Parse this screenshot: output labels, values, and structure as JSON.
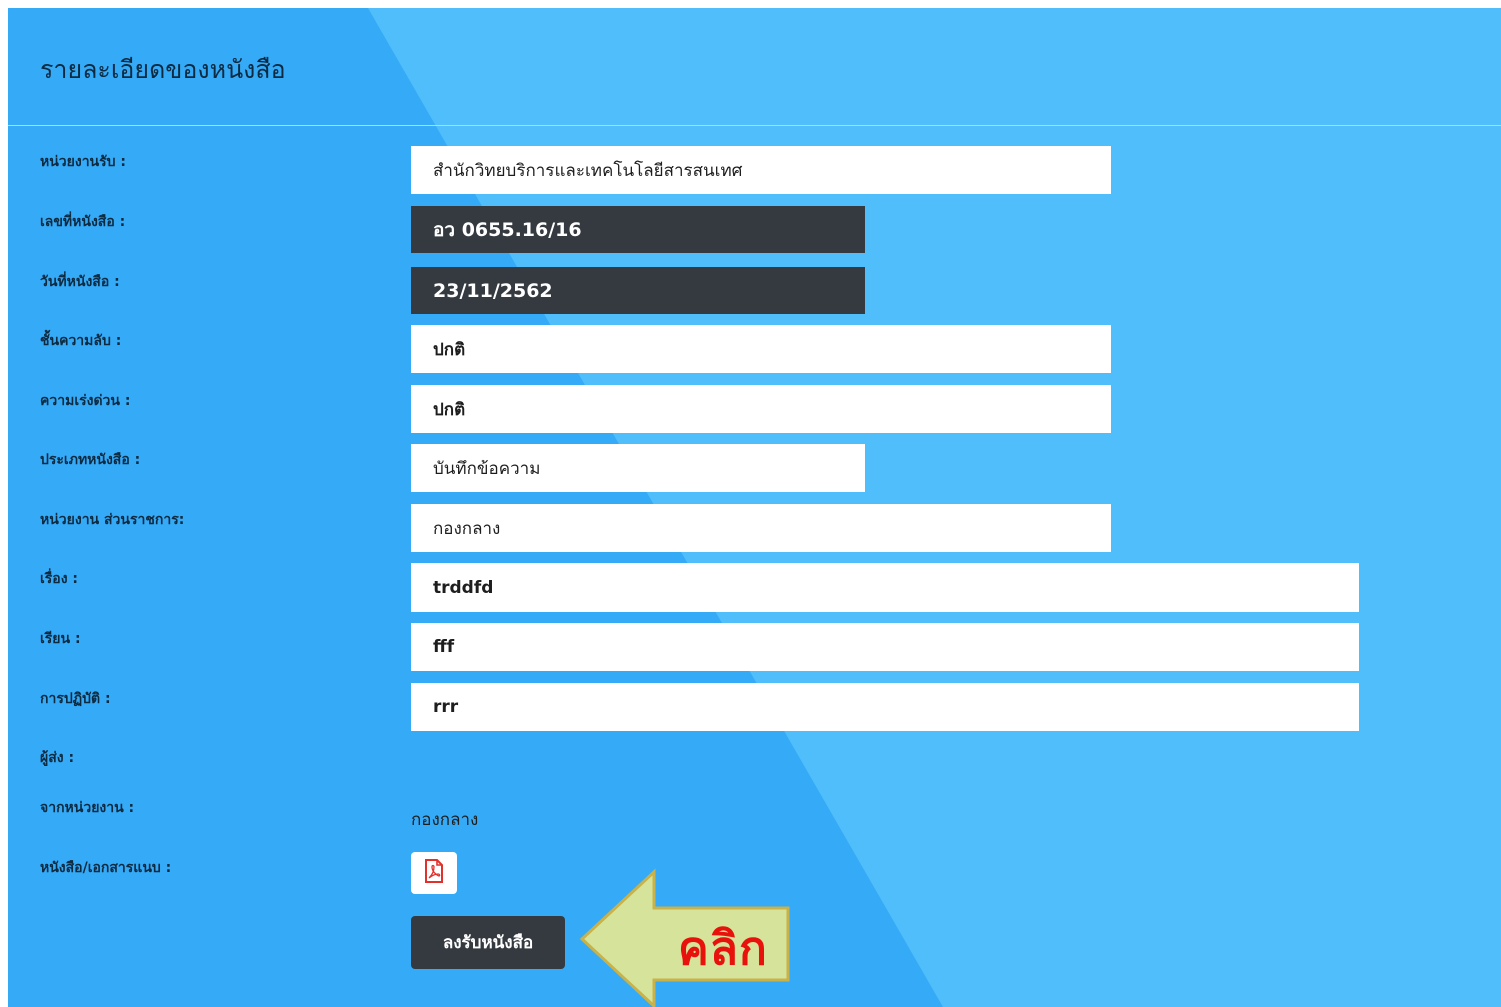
{
  "page": {
    "title": "รายละเอียดของหนังสือ"
  },
  "form": {
    "fields": [
      {
        "label": "หน่วยงานรับ :",
        "value": "สำนักวิทยบริการและเทคโนโลยีสารสนเทศ"
      },
      {
        "label": "เลขที่หนังสือ :",
        "value": "อว 0655.16/16"
      },
      {
        "label": "วันที่หนังสือ :",
        "value": "23/11/2562"
      },
      {
        "label": "ชั้นความลับ :",
        "value": "ปกติ"
      },
      {
        "label": "ความเร่งด่วน :",
        "value": "ปกติ"
      },
      {
        "label": "ประเภทหนังสือ :",
        "value": "บันทึกข้อความ"
      },
      {
        "label": "หน่วยงาน ส่วนราชการ:",
        "value": "กองกลาง"
      },
      {
        "label": "เรื่อง :",
        "value": "trddfd"
      },
      {
        "label": "เรียน :",
        "value": "fff"
      },
      {
        "label": "การปฏิบัติ :",
        "value": "rrr"
      }
    ],
    "sender_label": "ผู้ส่ง :",
    "from_unit_label": "จากหน่วยงาน :",
    "from_unit_value": "กองกลาง",
    "attachment_label": "หนังสือ/เอกสารแนบ :",
    "attachment_icon": "pdf-file-icon",
    "submit_label": "ลงรับหนังสือ"
  },
  "annotation": {
    "text": "คลิก",
    "arrow_fill": "#d5e49a",
    "arrow_stroke": "#c9b24a",
    "text_color": "#e8120c"
  },
  "colors": {
    "panel_blue": "#35abf8",
    "panel_blue_light": "#4fbefb",
    "dark_field": "#353a40"
  }
}
